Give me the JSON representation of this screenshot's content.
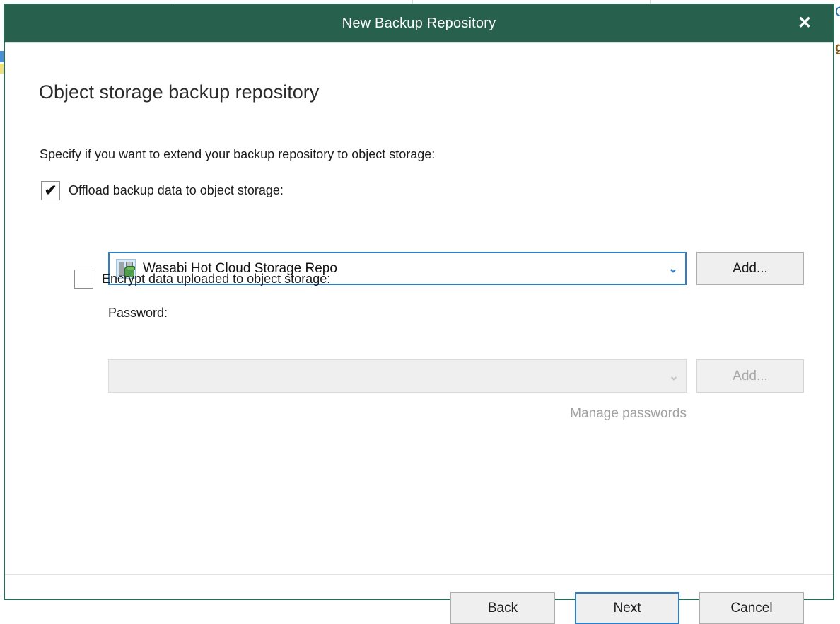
{
  "window": {
    "title": "New Backup Repository",
    "close_icon": "close-icon",
    "close_glyph": "✕",
    "titlebar_color": "#27614d",
    "border_color": "#2b6a54"
  },
  "page": {
    "heading": "Object storage backup repository",
    "intro": "Specify if you want to extend your backup repository to object storage:"
  },
  "offload": {
    "label": "Offload backup data to object storage:",
    "checked": true,
    "check_glyph": "✔",
    "repository": {
      "selected": "Wasabi Hot Cloud Storage Repo",
      "icon": "object-storage-repository-icon",
      "chevron": "⌄",
      "focused": true,
      "accent_color": "#2f7ec4"
    },
    "add_label": "Add..."
  },
  "encrypt": {
    "label": "Encrypt data uploaded to object storage:",
    "checked": false,
    "password_label": "Password:",
    "password_value": "",
    "password_placeholder": "",
    "password_enabled": false,
    "add_label": "Add...",
    "manage_passwords_label": "Manage passwords"
  },
  "footer": {
    "back_label": "Back",
    "next_label": "Next",
    "cancel_label": "Cancel",
    "focused_button": "Next"
  },
  "background": {
    "glyph_top_right": "C",
    "glyph_bottom_right": "g"
  }
}
